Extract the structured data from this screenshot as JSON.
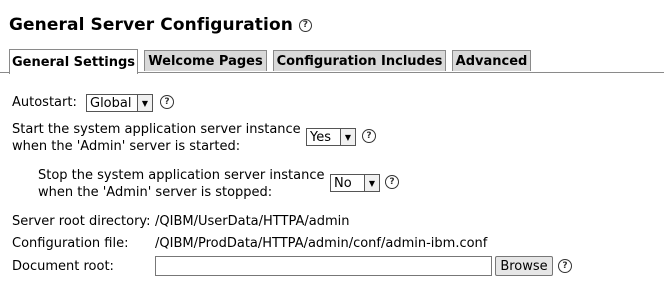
{
  "header": {
    "title": "General Server Configuration",
    "help_glyph": "?"
  },
  "tabs": [
    {
      "label": "General Settings",
      "active": true
    },
    {
      "label": "Welcome Pages",
      "active": false
    },
    {
      "label": "Configuration Includes",
      "active": false
    },
    {
      "label": "Advanced",
      "active": false
    }
  ],
  "form": {
    "autostart": {
      "label": "Autostart:",
      "value": "Global"
    },
    "start_instance": {
      "label_line1": "Start the system application server instance",
      "label_line2": "when the 'Admin' server is started:",
      "value": "Yes"
    },
    "stop_instance": {
      "label_line1": "Stop the system application server instance",
      "label_line2": "when the 'Admin' server is stopped:",
      "value": "No"
    },
    "server_root": {
      "label": "Server root directory:",
      "value": "/QIBM/UserData/HTTPA/admin"
    },
    "config_file": {
      "label": "Configuration file:",
      "value": "/QIBM/ProdData/HTTPA/admin/conf/admin-ibm.conf"
    },
    "document_root": {
      "label": "Document root:",
      "value": "",
      "browse_label": "Browse"
    }
  },
  "icons": {
    "help": "help-icon",
    "dropdown": "chevron-down-icon"
  }
}
